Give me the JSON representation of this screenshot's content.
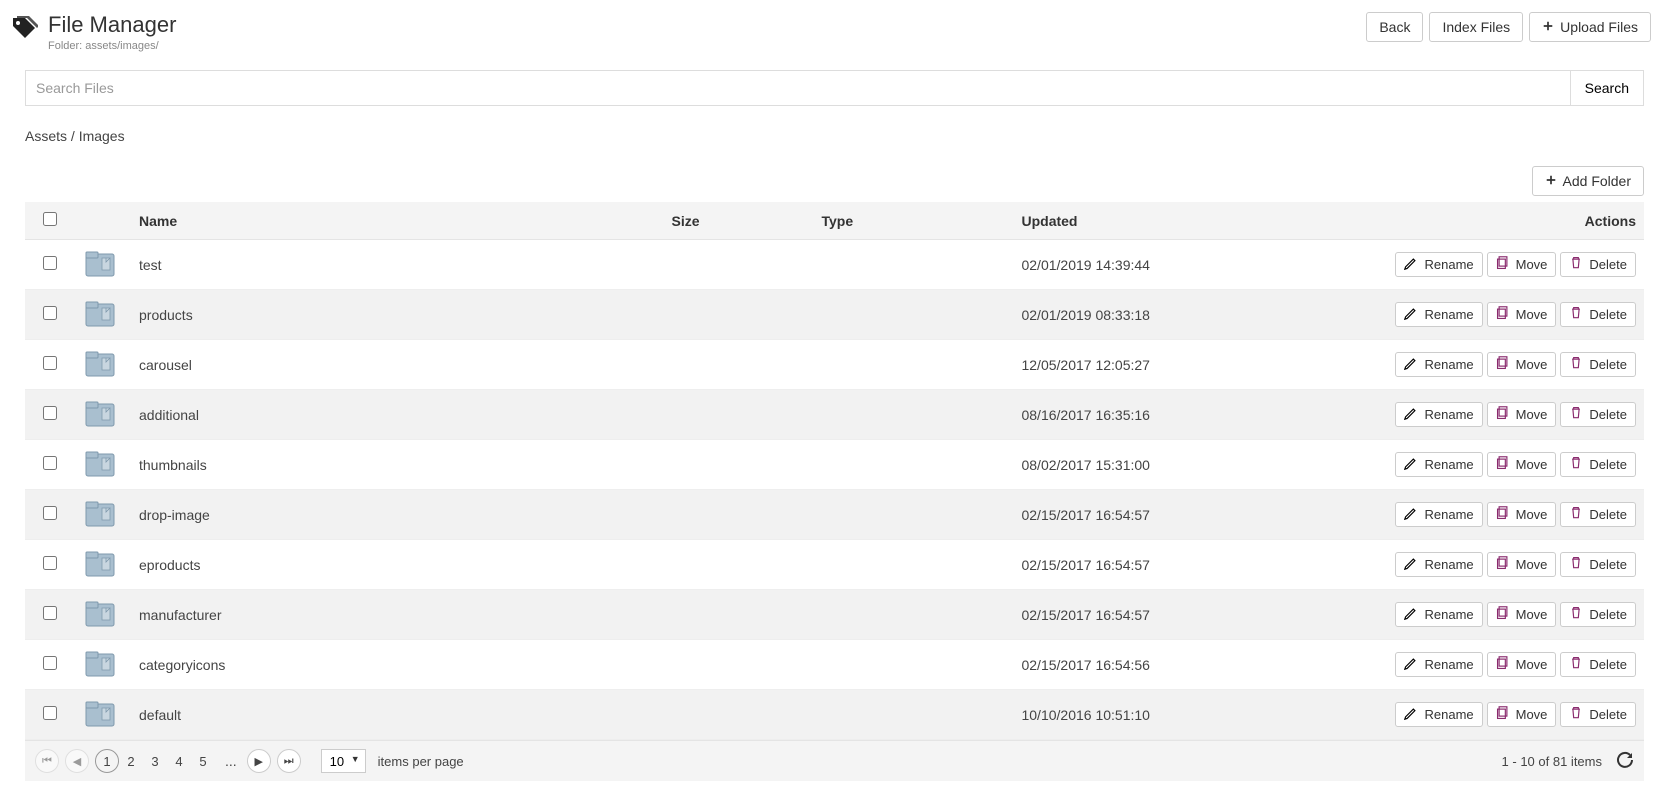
{
  "header": {
    "title": "File Manager",
    "folder_label_prefix": "Folder: ",
    "folder_path": "assets/images/",
    "buttons": {
      "back": "Back",
      "index": "Index Files",
      "upload": "Upload Files"
    }
  },
  "search": {
    "placeholder": "Search Files",
    "button": "Search"
  },
  "breadcrumb": {
    "assets": "Assets",
    "sep": " / ",
    "images": "Images"
  },
  "toolbar": {
    "add_folder": "Add Folder"
  },
  "table": {
    "columns": {
      "name": "Name",
      "size": "Size",
      "type": "Type",
      "updated": "Updated",
      "actions": "Actions"
    }
  },
  "actions": {
    "rename": "Rename",
    "move": "Move",
    "delete": "Delete"
  },
  "rows": [
    {
      "name": "test",
      "size": "",
      "type": "",
      "updated": "02/01/2019 14:39:44"
    },
    {
      "name": "products",
      "size": "",
      "type": "",
      "updated": "02/01/2019 08:33:18"
    },
    {
      "name": "carousel",
      "size": "",
      "type": "",
      "updated": "12/05/2017 12:05:27"
    },
    {
      "name": "additional",
      "size": "",
      "type": "",
      "updated": "08/16/2017 16:35:16"
    },
    {
      "name": "thumbnails",
      "size": "",
      "type": "",
      "updated": "08/02/2017 15:31:00"
    },
    {
      "name": "drop-image",
      "size": "",
      "type": "",
      "updated": "02/15/2017 16:54:57"
    },
    {
      "name": "eproducts",
      "size": "",
      "type": "",
      "updated": "02/15/2017 16:54:57"
    },
    {
      "name": "manufacturer",
      "size": "",
      "type": "",
      "updated": "02/15/2017 16:54:57"
    },
    {
      "name": "categoryicons",
      "size": "",
      "type": "",
      "updated": "02/15/2017 16:54:56"
    },
    {
      "name": "default",
      "size": "",
      "type": "",
      "updated": "10/10/2016 10:51:10"
    }
  ],
  "pager": {
    "pages": [
      "1",
      "2",
      "3",
      "4",
      "5"
    ],
    "current": "1",
    "ellipsis": "...",
    "page_size": "10",
    "per_page_label": "items per page",
    "status": "1 - 10 of 81 items"
  }
}
